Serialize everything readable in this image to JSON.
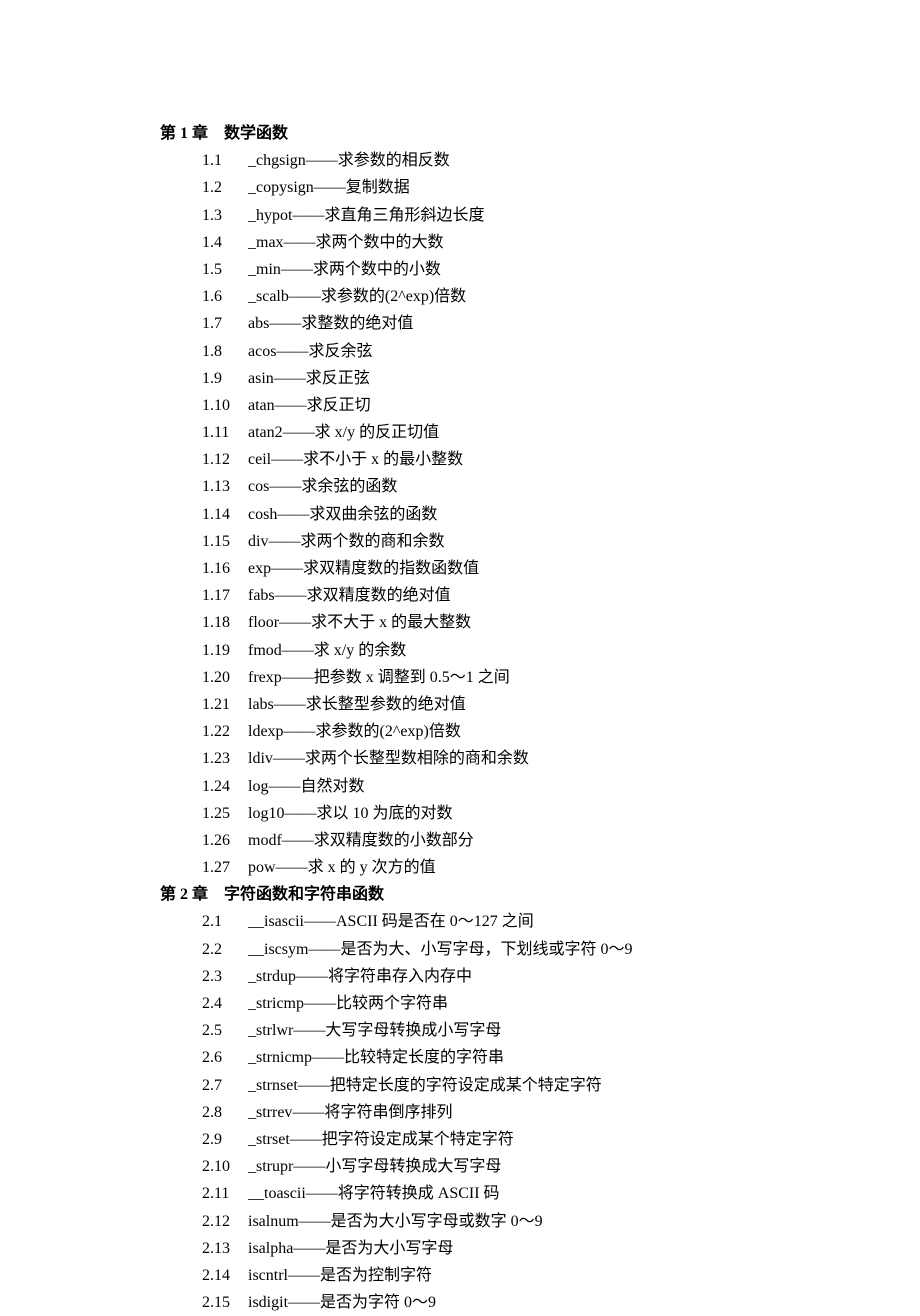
{
  "chapters": [
    {
      "title_prefix": "第",
      "title_num": " 1 ",
      "title_mid": "章　",
      "title_text": "数学函数",
      "items": [
        {
          "num": "1.1",
          "latin": "_chgsign",
          "desc": "——求参数的相反数"
        },
        {
          "num": "1.2",
          "latin": "_copysign",
          "desc": "——复制数据"
        },
        {
          "num": "1.3",
          "latin": "_hypot",
          "desc": "——求直角三角形斜边长度"
        },
        {
          "num": "1.4",
          "latin": "_max",
          "desc": "——求两个数中的大数"
        },
        {
          "num": "1.5",
          "latin": "_min",
          "desc": "——求两个数中的小数"
        },
        {
          "num": "1.6",
          "latin": "_scalb",
          "desc": "——求参数的(2^exp)倍数"
        },
        {
          "num": "1.7",
          "latin": "abs",
          "desc": "——求整数的绝对值"
        },
        {
          "num": "1.8",
          "latin": "acos",
          "desc": "——求反余弦"
        },
        {
          "num": "1.9",
          "latin": "asin",
          "desc": "——求反正弦"
        },
        {
          "num": "1.10",
          "latin": "atan",
          "desc": "——求反正切"
        },
        {
          "num": "1.11",
          "latin": "atan2",
          "desc": "——求 x/y 的反正切值"
        },
        {
          "num": "1.12",
          "latin": "ceil",
          "desc": "——求不小于 x 的最小整数"
        },
        {
          "num": "1.13",
          "latin": "cos",
          "desc": "——求余弦的函数"
        },
        {
          "num": "1.14",
          "latin": "cosh",
          "desc": "——求双曲余弦的函数"
        },
        {
          "num": "1.15",
          "latin": "div",
          "desc": "——求两个数的商和余数"
        },
        {
          "num": "1.16",
          "latin": "exp",
          "desc": "——求双精度数的指数函数值"
        },
        {
          "num": "1.17",
          "latin": "fabs",
          "desc": "——求双精度数的绝对值"
        },
        {
          "num": "1.18",
          "latin": "floor",
          "desc": "——求不大于 x 的最大整数"
        },
        {
          "num": "1.19",
          "latin": "fmod",
          "desc": "——求 x/y 的余数"
        },
        {
          "num": "1.20",
          "latin": "frexp",
          "desc": "——把参数 x 调整到 0.5～1 之间"
        },
        {
          "num": "1.21",
          "latin": "labs",
          "desc": "——求长整型参数的绝对值"
        },
        {
          "num": "1.22",
          "latin": "ldexp",
          "desc": "——求参数的(2^exp)倍数"
        },
        {
          "num": "1.23",
          "latin": "ldiv",
          "desc": "——求两个长整型数相除的商和余数"
        },
        {
          "num": "1.24",
          "latin": "log",
          "desc": "——自然对数"
        },
        {
          "num": "1.25",
          "latin": "log10",
          "desc": "——求以 10 为底的对数"
        },
        {
          "num": "1.26",
          "latin": "modf",
          "desc": "——求双精度数的小数部分"
        },
        {
          "num": "1.27",
          "latin": "pow",
          "desc": "——求 x 的 y 次方的值"
        }
      ]
    },
    {
      "title_prefix": "第",
      "title_num": " 2 ",
      "title_mid": "章　",
      "title_text": "字符函数和字符串函数",
      "items": [
        {
          "num": "2.1",
          "latin": "__isascii",
          "desc": "——ASCII 码是否在 0～127 之间"
        },
        {
          "num": "2.2",
          "latin": "__iscsym",
          "desc": "——是否为大、小写字母，下划线或字符 0～9"
        },
        {
          "num": "2.3",
          "latin": "_strdup",
          "desc": "——将字符串存入内存中"
        },
        {
          "num": "2.4",
          "latin": "_stricmp",
          "desc": "——比较两个字符串"
        },
        {
          "num": "2.5",
          "latin": "_strlwr",
          "desc": "——大写字母转换成小写字母"
        },
        {
          "num": "2.6",
          "latin": "_strnicmp",
          "desc": "——比较特定长度的字符串"
        },
        {
          "num": "2.7",
          "latin": "_strnset",
          "desc": "——把特定长度的字符设定成某个特定字符"
        },
        {
          "num": "2.8",
          "latin": "_strrev",
          "desc": "——将字符串倒序排列"
        },
        {
          "num": "2.9",
          "latin": "_strset",
          "desc": "——把字符设定成某个特定字符"
        },
        {
          "num": "2.10",
          "latin": "_strupr",
          "desc": "——小写字母转换成大写字母"
        },
        {
          "num": "2.11",
          "latin": "__toascii",
          "desc": "——将字符转换成 ASCII 码"
        },
        {
          "num": "2.12",
          "latin": "isalnum",
          "desc": "——是否为大小写字母或数字 0～9"
        },
        {
          "num": "2.13",
          "latin": "isalpha",
          "desc": "——是否为大小写字母"
        },
        {
          "num": "2.14",
          "latin": "iscntrl",
          "desc": "——是否为控制字符"
        },
        {
          "num": "2.15",
          "latin": "isdigit",
          "desc": "——是否为字符 0～9"
        }
      ]
    }
  ]
}
